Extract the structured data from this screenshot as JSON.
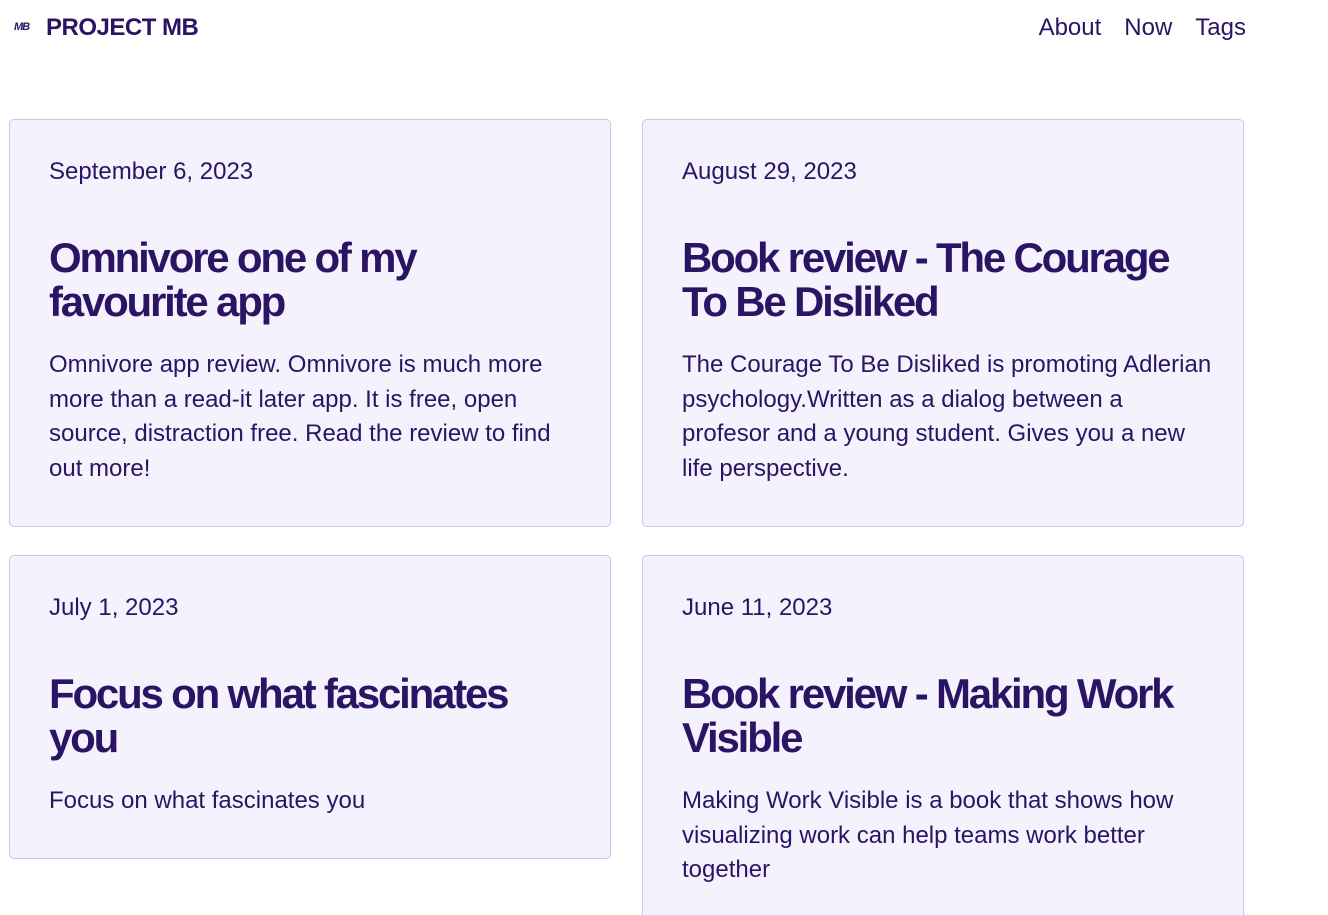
{
  "site": {
    "logo_mark": "MB",
    "brand": "PROJECT MB"
  },
  "nav": {
    "items": [
      "About",
      "Now",
      "Tags"
    ]
  },
  "posts": [
    {
      "date": "September 6, 2023",
      "title": "Omnivore one of my favourite app",
      "description": "Omnivore app review. Omnivore is much more more than a read-it later app. It is free, open source, distraction free. Read the review to find out more!"
    },
    {
      "date": "August 29, 2023",
      "title": "Book review - The Courage To Be Disliked",
      "description": "The Courage To Be Disliked is promoting Adlerian psychology.Written as a dialog between a profesor and a young student. Gives you a new life perspective."
    },
    {
      "date": "July 1, 2023",
      "title": "Focus on what fascinates you",
      "description": "Focus on what fascinates you"
    },
    {
      "date": "June 11, 2023",
      "title": "Book review - Making Work Visible",
      "description": "Making Work Visible is a book that shows how visualizing work can help teams work better together"
    }
  ],
  "colors": {
    "text": "#2b1463",
    "card_bg": "#f4f2fd",
    "card_border": "#c9c3ee"
  }
}
